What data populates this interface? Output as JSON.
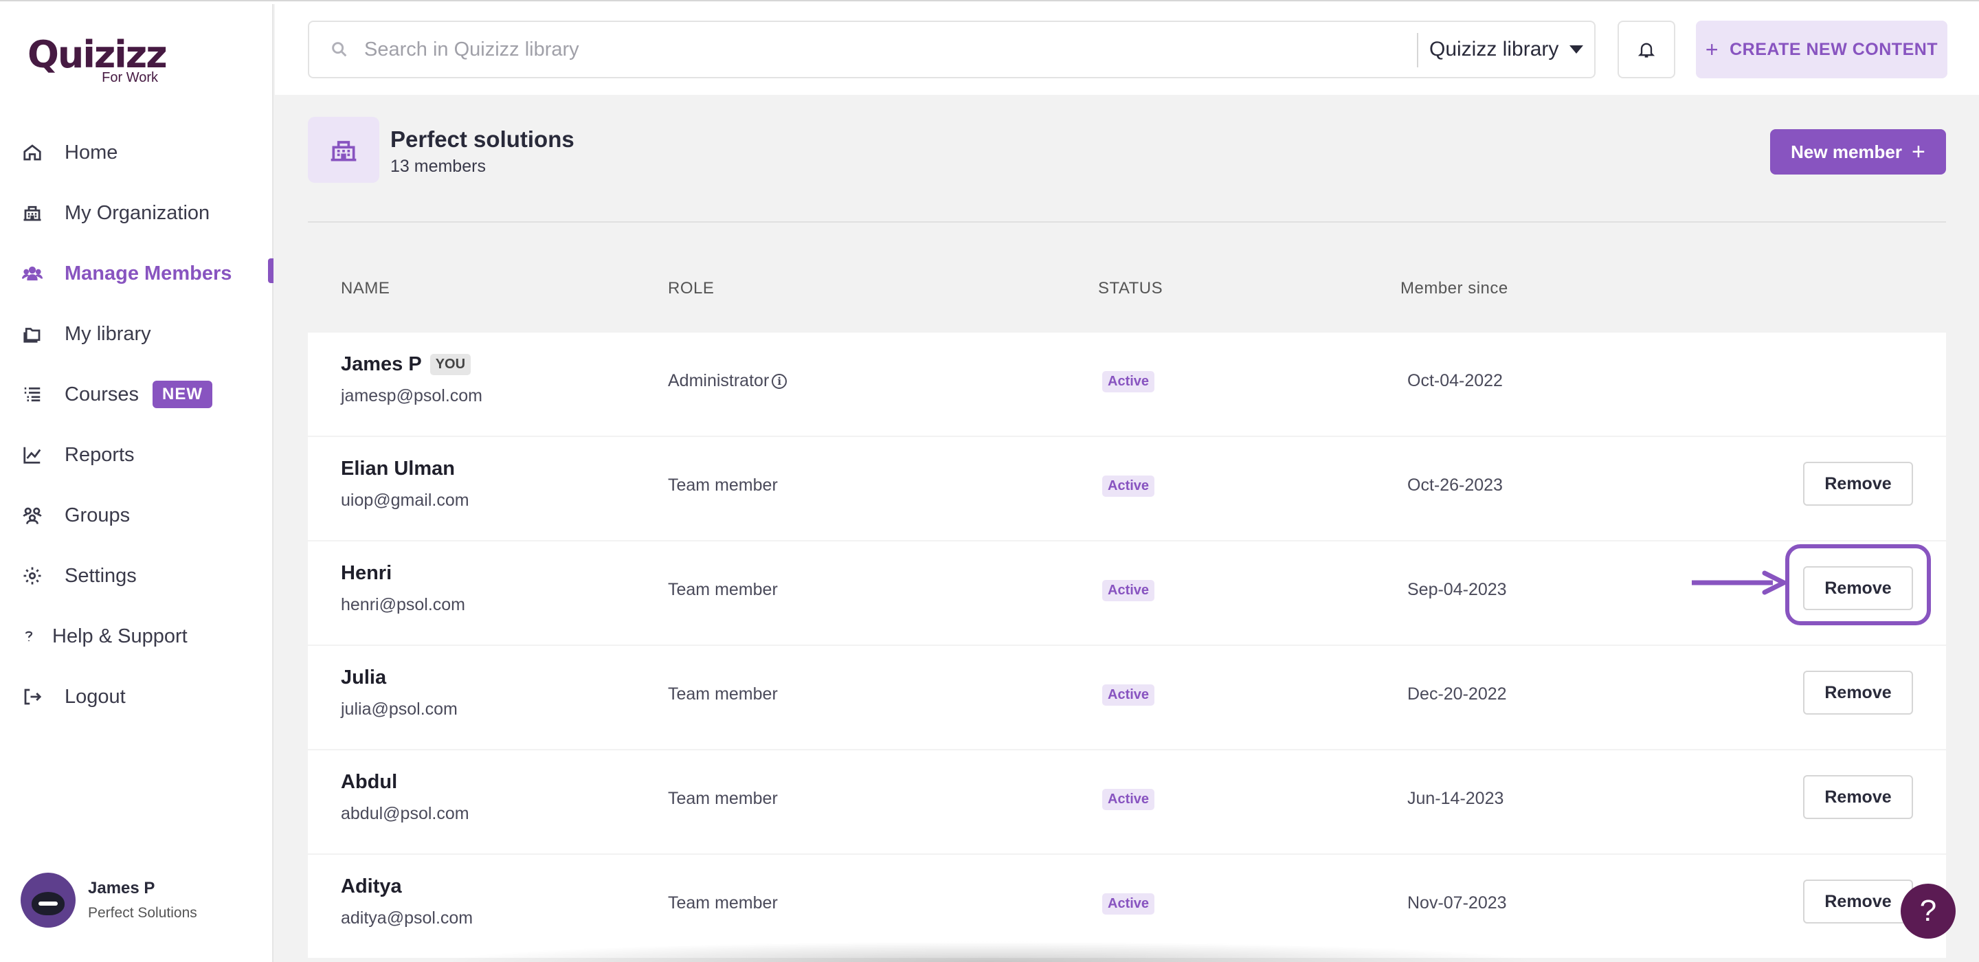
{
  "app": {
    "logo_text": "Quizizz",
    "logo_subtitle": "For Work"
  },
  "sidebar": {
    "items": [
      {
        "label": "Home",
        "icon": "home-icon"
      },
      {
        "label": "My Organization",
        "icon": "building-icon"
      },
      {
        "label": "Manage Members",
        "icon": "users-icon",
        "active": true
      },
      {
        "label": "My library",
        "icon": "folder-icon"
      },
      {
        "label": "Courses",
        "icon": "list-icon",
        "badge": "NEW"
      },
      {
        "label": "Reports",
        "icon": "chart-icon"
      },
      {
        "label": "Groups",
        "icon": "groups-icon"
      },
      {
        "label": "Settings",
        "icon": "gear-icon"
      },
      {
        "label": "Help & Support",
        "icon": "question-icon"
      },
      {
        "label": "Logout",
        "icon": "logout-icon"
      }
    ],
    "profile": {
      "name": "James P",
      "org": "Perfect Solutions"
    }
  },
  "topbar": {
    "search_placeholder": "Search in Quizizz library",
    "library_label": "Quizizz library",
    "create_label": "CREATE NEW CONTENT"
  },
  "org": {
    "title": "Perfect solutions",
    "member_count": "13 members",
    "new_member_label": "New member"
  },
  "table": {
    "headers": {
      "name": "NAME",
      "role": "ROLE",
      "status": "STATUS",
      "since": "Member since"
    },
    "rows": [
      {
        "name": "James P",
        "tag": "YOU",
        "email": "jamesp@psol.com",
        "role": "Administrator",
        "status": "Active",
        "since": "Oct-04-2022",
        "remove": ""
      },
      {
        "name": "Elian Ulman",
        "email": "uiop@gmail.com",
        "role": "Team member",
        "status": "Active",
        "since": "Oct-26-2023",
        "remove": "Remove"
      },
      {
        "name": "Henri",
        "email": "henri@psol.com",
        "role": "Team member",
        "status": "Active",
        "since": "Sep-04-2023",
        "remove": "Remove"
      },
      {
        "name": "Julia",
        "email": "julia@psol.com",
        "role": "Team member",
        "status": "Active",
        "since": "Dec-20-2022",
        "remove": "Remove"
      },
      {
        "name": "Abdul",
        "email": "abdul@psol.com",
        "role": "Team member",
        "status": "Active",
        "since": "Jun-14-2023",
        "remove": "Remove"
      },
      {
        "name": "Aditya",
        "email": "aditya@psol.com",
        "role": "Team member",
        "status": "Active",
        "since": "Nov-07-2023",
        "remove": "Remove"
      }
    ]
  },
  "help_button": "?",
  "colors": {
    "accent": "#8854c0",
    "logo": "#461a42",
    "help": "#5b1b53"
  }
}
